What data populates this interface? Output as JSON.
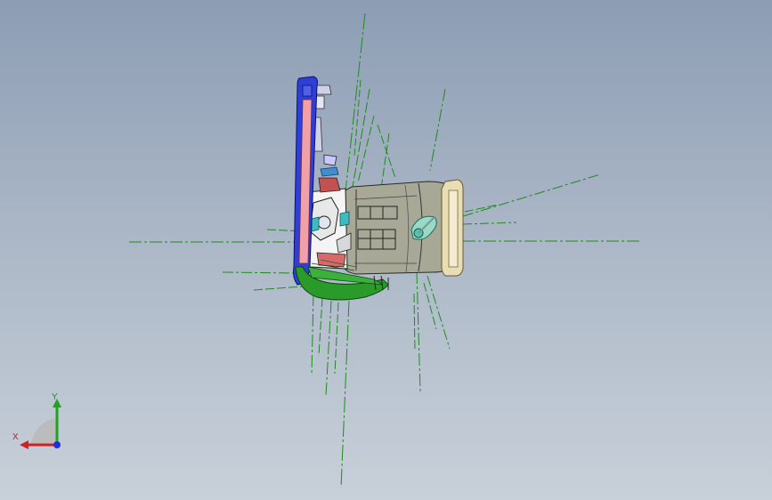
{
  "viewport": {
    "background_top": "#8c9db4",
    "background_bottom": "#c8d0d9"
  },
  "model": {
    "description_colors": {
      "housing": "#a8a897",
      "frame_blue": "#2f3fd6",
      "base_green": "#2a9a2a",
      "flange": "#e8ddb5",
      "construction_lines": "#1e8c1e"
    }
  },
  "triad": {
    "x_label": "X",
    "y_label": "Y",
    "x_color": "#d22020",
    "y_color": "#1fa41f",
    "z_color": "#2030d8"
  }
}
